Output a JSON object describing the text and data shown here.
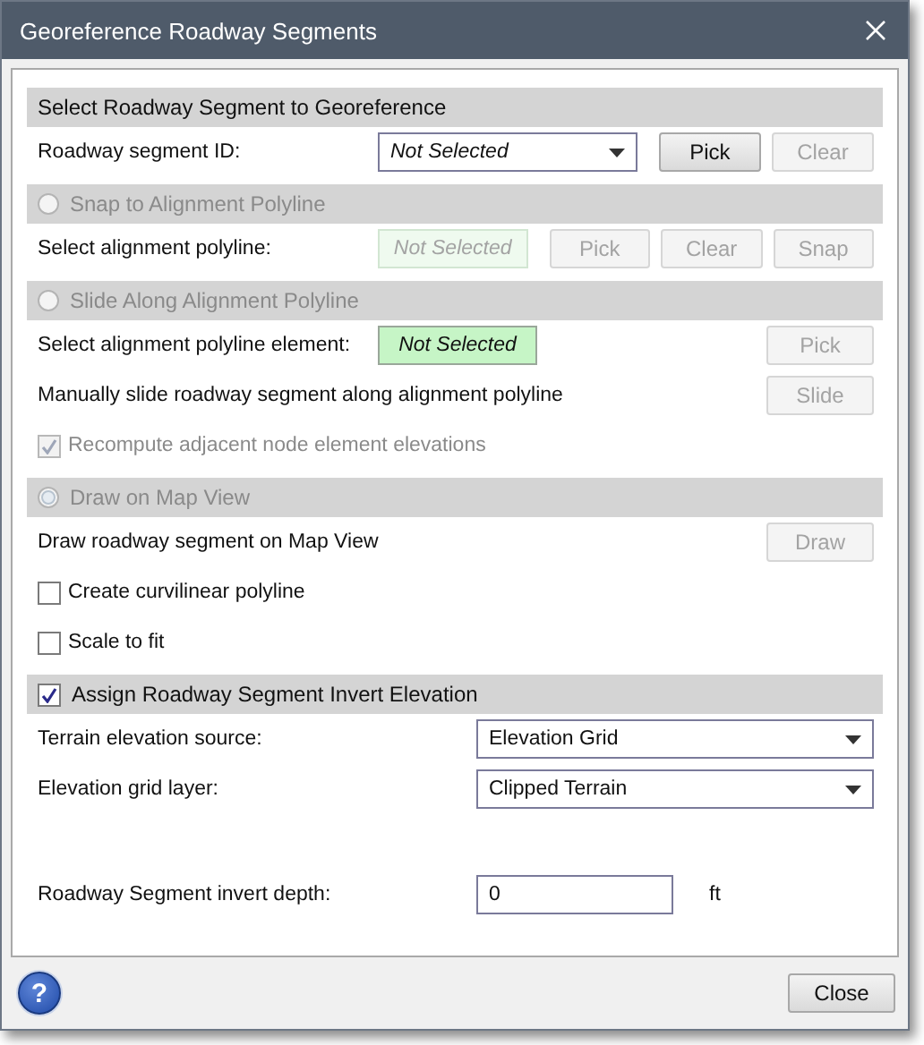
{
  "window": {
    "title": "Georeference Roadway Segments"
  },
  "sections": [
    {
      "header": {
        "kind": "plain",
        "label": "Select Roadway Segment to Georeference"
      },
      "rows": [
        {
          "kind": "select",
          "label": "Roadway segment ID:",
          "field": {
            "kind": "dropdown",
            "value": "Not Selected"
          },
          "buttons": [
            {
              "label": "Pick",
              "disabled": false
            },
            {
              "label": "Clear",
              "disabled": true
            }
          ]
        }
      ]
    },
    {
      "header": {
        "kind": "radio",
        "label": "Snap to Alignment Polyline",
        "selected": false,
        "disabled": true
      },
      "rows": [
        {
          "kind": "select",
          "label": "Select alignment polyline:",
          "field": {
            "kind": "display",
            "value": "Not Selected",
            "disabled": true
          },
          "buttons": [
            {
              "label": "Pick",
              "disabled": true
            },
            {
              "label": "Clear",
              "disabled": true
            },
            {
              "label": "Snap",
              "disabled": true
            }
          ]
        }
      ]
    },
    {
      "header": {
        "kind": "radio",
        "label": "Slide Along Alignment Polyline",
        "selected": false,
        "disabled": true
      },
      "rows": [
        {
          "kind": "select",
          "label": "Select alignment polyline element:",
          "field": {
            "kind": "display",
            "value": "Not Selected",
            "disabled": false
          },
          "buttons": [
            {
              "label": "Pick",
              "disabled": true
            }
          ]
        },
        {
          "kind": "action",
          "label": "Manually slide roadway segment along alignment polyline",
          "buttons": [
            {
              "label": "Slide",
              "disabled": true
            }
          ]
        },
        {
          "kind": "checkbox",
          "label": "Recompute adjacent node element elevations",
          "checked": true,
          "disabled": true
        }
      ]
    },
    {
      "header": {
        "kind": "radio",
        "label": "Draw on Map View",
        "selected": true,
        "disabled": true
      },
      "rows": [
        {
          "kind": "action",
          "label": "Draw roadway segment on Map View",
          "buttons": [
            {
              "label": "Draw",
              "disabled": true
            }
          ]
        },
        {
          "kind": "checkbox",
          "label": "Create curvilinear polyline",
          "checked": false,
          "disabled": false
        },
        {
          "kind": "checkbox",
          "label": "Scale to fit",
          "checked": false,
          "disabled": false
        }
      ]
    },
    {
      "header": {
        "kind": "checkbox",
        "label": "Assign Roadway Segment Invert Elevation",
        "checked": true,
        "disabled": false
      },
      "rows": [
        {
          "kind": "combo",
          "label": "Terrain elevation source:",
          "value": "Elevation Grid"
        },
        {
          "kind": "combo",
          "label": "Elevation grid layer:",
          "value": "Clipped Terrain"
        },
        {
          "kind": "number",
          "label": "Roadway Segment invert depth:",
          "value": "0",
          "unit": "ft"
        }
      ]
    }
  ],
  "footer": {
    "help": "?",
    "close": "Close"
  }
}
